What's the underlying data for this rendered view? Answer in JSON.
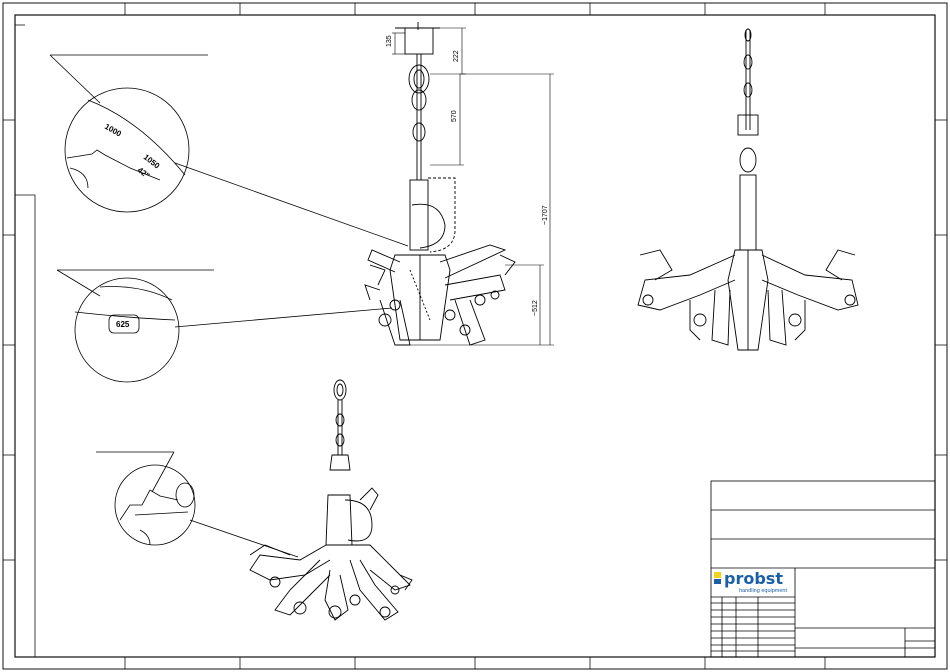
{
  "dimensions": {
    "d135": "135",
    "d222": "222",
    "d570": "570",
    "d1707": "~1707",
    "d512": "~512"
  },
  "details": {
    "detail_1": {
      "mark_1000": "1000",
      "mark_1050": "1050",
      "mark_42": "42\""
    },
    "detail_2": {
      "mark_625": "625"
    }
  },
  "title_block": {
    "company": "probst",
    "tagline": "handling equipment",
    "colors": {
      "logo_yellow": "#f2d21b",
      "logo_blue": "#1b5fa8"
    }
  },
  "colors": {
    "line": "#000000",
    "border": "#111111",
    "background": "#ffffff"
  }
}
